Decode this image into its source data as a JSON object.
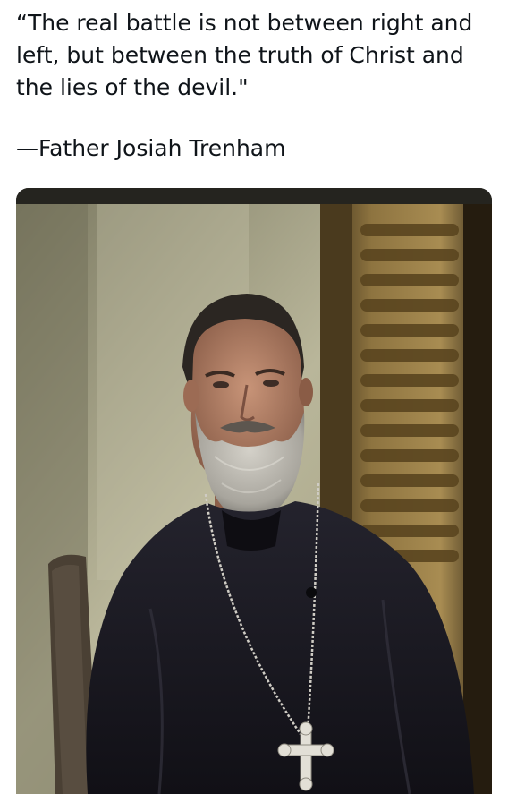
{
  "post": {
    "quote_text": "“The real battle is not between right and\nleft, but between the truth of Christ and\nthe lies of the devil.\"",
    "attribution": "—Father Josiah Trenham"
  },
  "photo": {
    "icon": "portrait-photo-icon",
    "colors": {
      "wall": "#b8b596",
      "wall_shadow": "#6d6b55",
      "shutter": "#8a6f3a",
      "shutter_dark": "#3a2d17",
      "cassock": "#1b1a22",
      "beard": "#b9b6ae",
      "skin": "#b9876d",
      "hair": "#2b2622",
      "chair": "#4a4034",
      "cross": "#e2dfd6"
    }
  }
}
